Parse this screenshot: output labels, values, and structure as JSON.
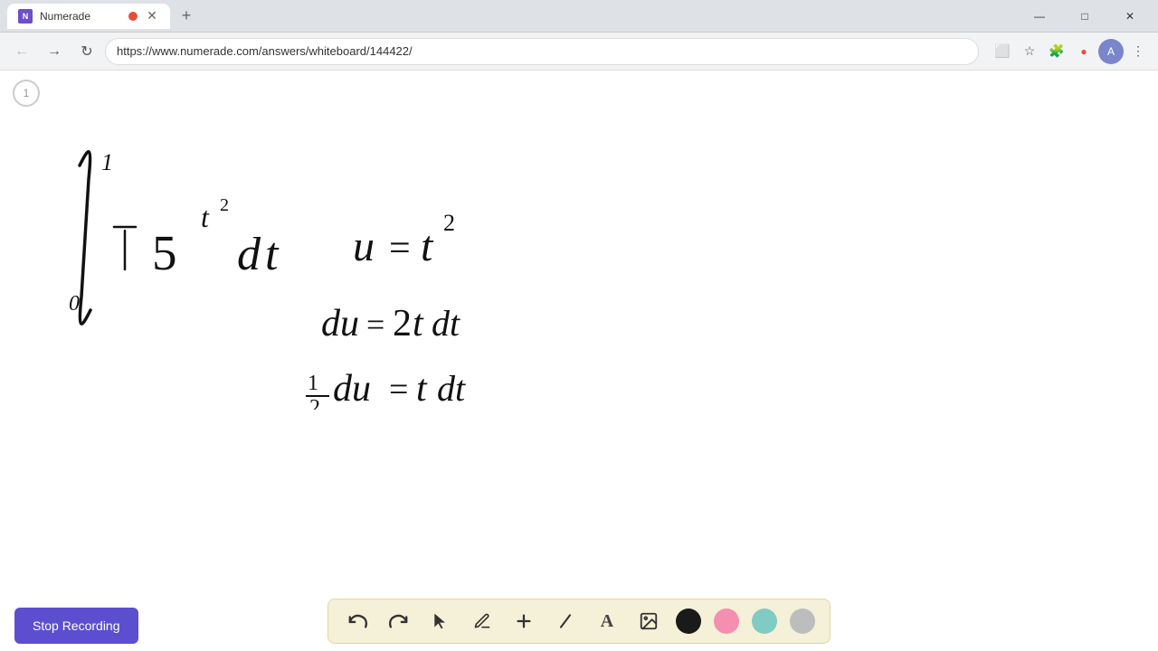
{
  "browser": {
    "tab": {
      "title": "Numerade",
      "url": "https://www.numerade.com/answers/whiteboard/144422/"
    },
    "window_controls": {
      "minimize": "—",
      "maximize": "□",
      "close": "✕"
    }
  },
  "page": {
    "number": "1",
    "math_label": "∫₀¹ t 5^(t²) dt     u = t²\n\ndu = 2t dt\n\n½ du = t dt"
  },
  "toolbar": {
    "stop_recording_label": "Stop Recording",
    "tools": [
      {
        "name": "undo",
        "symbol": "↺"
      },
      {
        "name": "redo",
        "symbol": "↻"
      },
      {
        "name": "select",
        "symbol": "↖"
      },
      {
        "name": "pen",
        "symbol": "✏"
      },
      {
        "name": "add",
        "symbol": "+"
      },
      {
        "name": "eraser",
        "symbol": "/"
      },
      {
        "name": "text",
        "symbol": "A"
      },
      {
        "name": "image",
        "symbol": "🖼"
      }
    ],
    "colors": [
      {
        "name": "black",
        "hex": "#1a1a1a"
      },
      {
        "name": "pink",
        "hex": "#f48fb1"
      },
      {
        "name": "green",
        "hex": "#80cbc4"
      },
      {
        "name": "gray",
        "hex": "#bdbdbd"
      }
    ]
  }
}
